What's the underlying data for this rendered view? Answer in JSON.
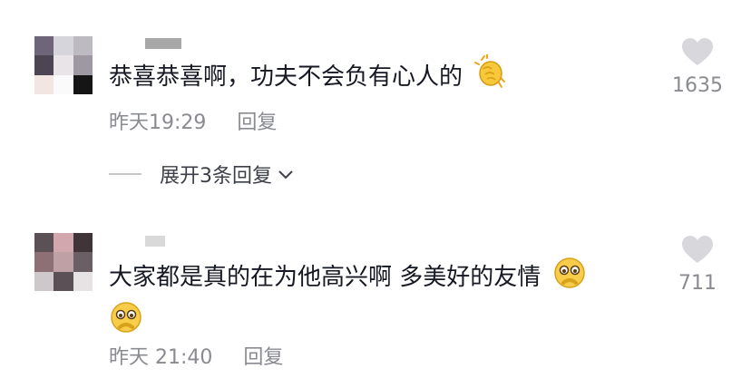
{
  "comments": [
    {
      "text": "恭喜恭喜啊，功夫不会负有心人的",
      "emoji_icon": "clapping-hands-icon",
      "time": "昨天19:29",
      "reply_label": "回复",
      "like_count": "1635",
      "expand_label": "展开3条回复"
    },
    {
      "text": "大家都是真的在为他高兴啊 多美好的友情",
      "emoji_icon": "pleading-face-icon",
      "time": "昨天 21:40",
      "reply_label": "回复",
      "like_count": "711"
    }
  ]
}
